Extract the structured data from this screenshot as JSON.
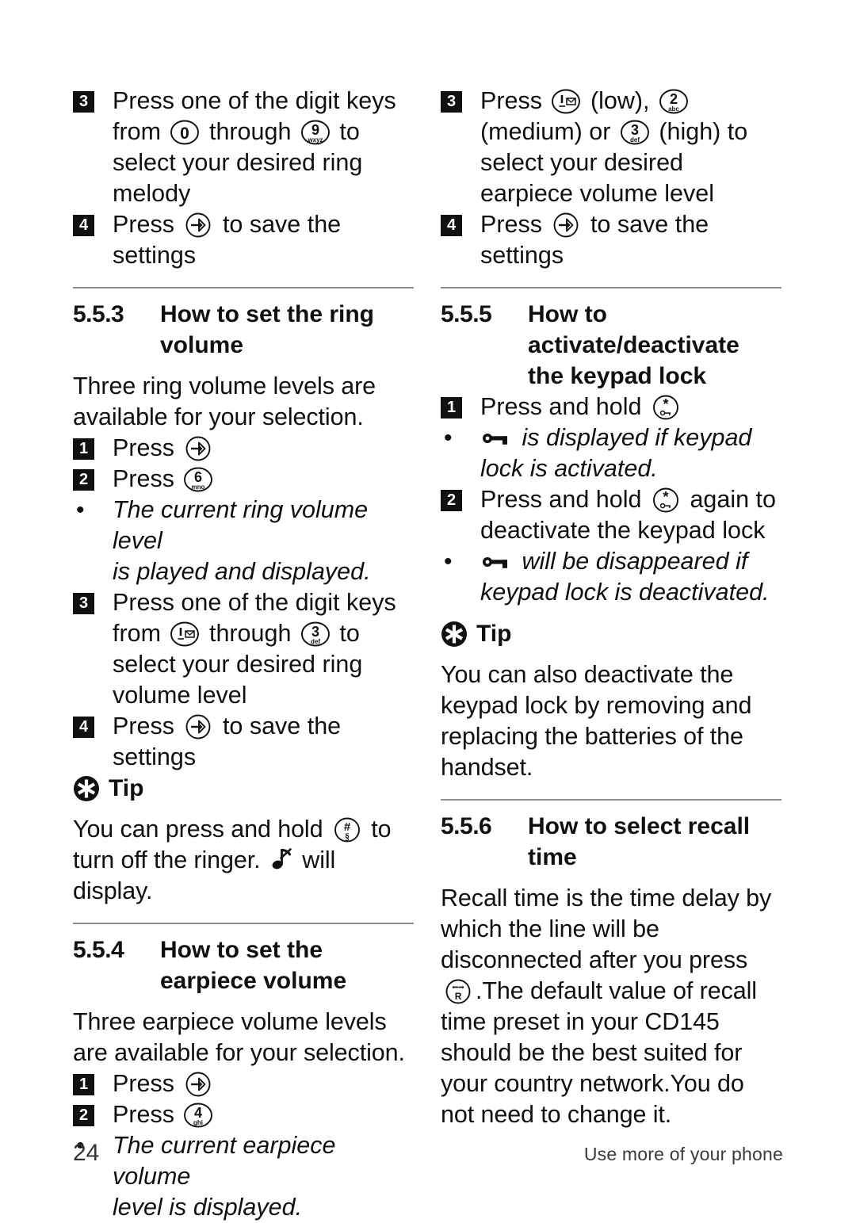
{
  "page": {
    "number": "24",
    "footer_note": "Use more of your phone"
  },
  "left_column": {
    "step3_ring_melody": {
      "number": "3",
      "text_a": "Press one of the digit keys",
      "text_b": "from",
      "key_from": "0",
      "text_c": "through",
      "key_to_digit": "9",
      "key_to_letters": "wxyz",
      "text_d": "to",
      "text_e": "select your desired ring",
      "text_f": "melody"
    },
    "step4_save": {
      "number": "4",
      "text_a": "Press",
      "key": "save-key",
      "text_b": "to save the settings"
    },
    "section_553": {
      "number": "5.5.3",
      "title_line1": "How to set the ring",
      "title_line2": "volume",
      "intro_line1": "Three ring volume levels are",
      "intro_line2": "available for your selection.",
      "step1": {
        "number": "1",
        "text": "Press",
        "key": "save-key"
      },
      "step2": {
        "number": "2",
        "text": "Press",
        "key_digit": "6",
        "key_letters": "mno"
      },
      "bullet1_line1": "The current ring volume level",
      "bullet1_line2": "is played and displayed.",
      "step3": {
        "number": "3",
        "text_a": "Press one of the digit keys",
        "text_b": "from",
        "key_from": "voicemail-key",
        "text_c": "through",
        "key_to_digit": "3",
        "key_to_letters": "def",
        "text_d": "to",
        "text_e": "select your desired ring",
        "text_f": "volume level"
      },
      "step4": {
        "number": "4",
        "text_a": "Press",
        "key": "save-key",
        "text_b": "to save the settings"
      },
      "tip": {
        "label": "Tip",
        "line1_a": "You can press and hold",
        "key_digit": "#",
        "key_letters": "§",
        "line1_b": "to",
        "line2_a": "turn off the ringer.",
        "glyph": "ringer-off-note",
        "line2_b": "will",
        "line3": "display."
      }
    },
    "section_554": {
      "number": "5.5.4",
      "title_line1": "How to set the",
      "title_line2": "earpiece volume",
      "intro_line1": "Three earpiece volume levels",
      "intro_line2": "are available for your selection.",
      "step1": {
        "number": "1",
        "text": "Press",
        "key": "save-key"
      },
      "step2": {
        "number": "2",
        "text": "Press",
        "key_digit": "4",
        "key_letters": "ghi"
      },
      "bullet1_line1": "The current earpiece volume",
      "bullet1_line2": "level is displayed."
    }
  },
  "right_column": {
    "step3_earpiece": {
      "number": "3",
      "text_a": "Press",
      "key_low": "voicemail-key",
      "text_low": "(low),",
      "key_med_digit": "2",
      "key_med_letters": "abc",
      "text_med": "(medium) or",
      "key_high_digit": "3",
      "key_high_letters": "def",
      "text_high": "(high) to",
      "text_b": "select your desired",
      "text_c": "earpiece volume level"
    },
    "step4_save": {
      "number": "4",
      "text_a": "Press",
      "key": "save-key",
      "text_b": "to save the",
      "text_c": "settings"
    },
    "section_555": {
      "number": "5.5.5",
      "title_line1": "How to",
      "title_line2": "activate/deactivate",
      "title_line3": "the keypad lock",
      "step1": {
        "number": "1",
        "text": "Press and hold",
        "key": "star-lock-key"
      },
      "bullet1_a": "is displayed if keypad",
      "bullet1_b": "lock is activated.",
      "step2": {
        "number": "2",
        "text_a": "Press and hold",
        "key": "star-lock-key",
        "text_b": "again to",
        "text_c": "deactivate the keypad lock"
      },
      "bullet2_a": "will be disappeared if",
      "bullet2_b": "keypad lock is deactivated.",
      "tip": {
        "label": "Tip",
        "line1": "You can also deactivate the",
        "line2": "keypad lock by removing and",
        "line3": "replacing the batteries of the",
        "line4": "handset."
      }
    },
    "section_556": {
      "number": "5.5.6",
      "title_line1": "How to select recall",
      "title_line2": "time",
      "body_line1": "Recall time is the time delay by",
      "body_line2": "which the line will be",
      "body_line3": "disconnected after you press",
      "body_key": "recall-key",
      "body_line4": ".The default value of recall",
      "body_line5": "time preset in your CD145",
      "body_line6": "should be the best suited for",
      "body_line7": "your country network.You do",
      "body_line8": "not need to change it."
    }
  },
  "colors": {
    "text": "#101010",
    "rule": "#8d8d8d",
    "step_badge_bg": "#111111",
    "step_badge_fg": "#ffffff"
  }
}
